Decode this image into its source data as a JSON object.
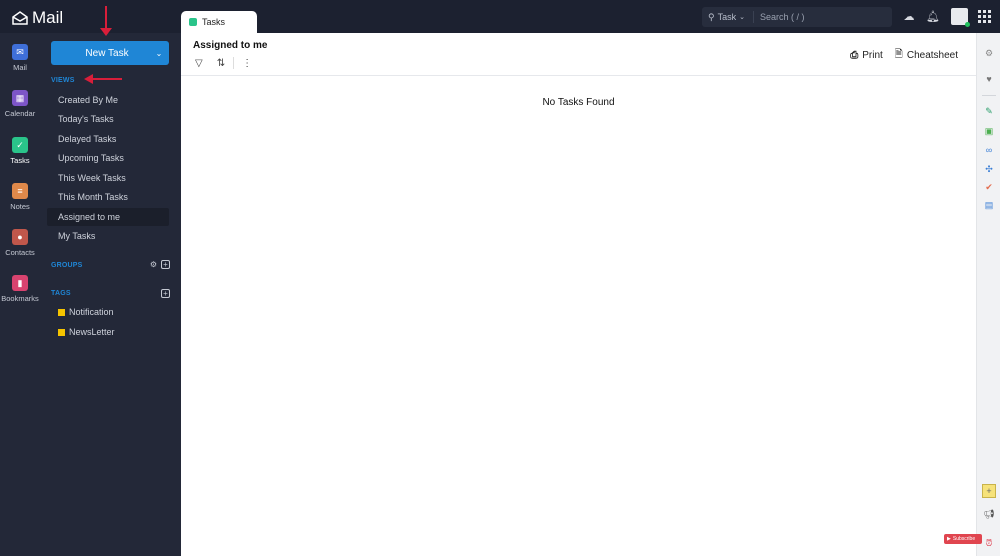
{
  "app": {
    "name": "Mail"
  },
  "tabs": [
    {
      "label": "Tasks"
    }
  ],
  "search": {
    "scope": "Task",
    "placeholder": "Search ( / )"
  },
  "apps": [
    {
      "label": "Mail",
      "color": "#3f6fd8",
      "icon": "mail-icon"
    },
    {
      "label": "Calendar",
      "color": "#7d55c7",
      "icon": "calendar-icon"
    },
    {
      "label": "Tasks",
      "color": "#2ac48a",
      "icon": "check-icon"
    },
    {
      "label": "Notes",
      "color": "#e0894a",
      "icon": "notes-icon"
    },
    {
      "label": "Contacts",
      "color": "#c0574b",
      "icon": "contact-icon"
    },
    {
      "label": "Bookmarks",
      "color": "#d8436f",
      "icon": "bookmark-icon"
    }
  ],
  "sidebar": {
    "new_task_label": "New Task",
    "views_heading": "VIEWS",
    "views": [
      {
        "label": "Created By Me"
      },
      {
        "label": "Today's Tasks"
      },
      {
        "label": "Delayed Tasks"
      },
      {
        "label": "Upcoming Tasks"
      },
      {
        "label": "This Week Tasks"
      },
      {
        "label": "This Month Tasks"
      },
      {
        "label": "Assigned to me",
        "active": true
      },
      {
        "label": "My Tasks"
      }
    ],
    "groups_heading": "GROUPS",
    "tags_heading": "TAGS",
    "tags": [
      {
        "label": "Notification",
        "color": "#f5c400"
      },
      {
        "label": "NewsLetter",
        "color": "#f5c400"
      }
    ]
  },
  "main": {
    "title": "Assigned to me",
    "print_label": "Print",
    "cheatsheet_label": "Cheatsheet",
    "empty_message": "No Tasks Found"
  },
  "overlay": {
    "subscribe_label": "Subscribe"
  },
  "colors": {
    "accent": "#1f86d6",
    "annotation_arrow": "#d81e3a"
  }
}
